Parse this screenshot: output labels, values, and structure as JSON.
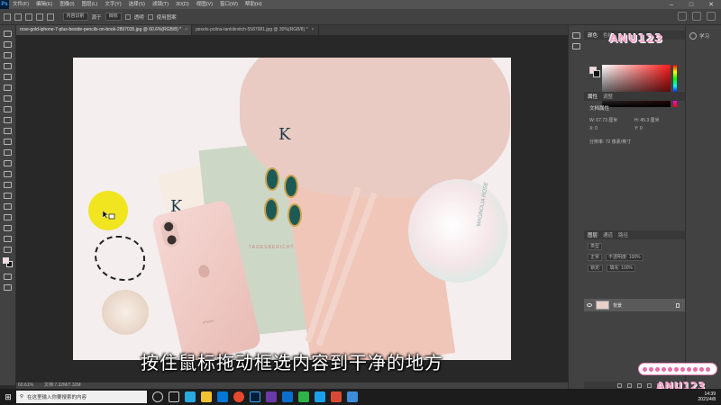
{
  "menubar": {
    "app_icon": "Ps",
    "items": [
      "文件(F)",
      "编辑(E)",
      "图像(I)",
      "图层(L)",
      "文字(Y)",
      "选择(S)",
      "滤镜(T)",
      "3D(D)",
      "视图(V)",
      "窗口(W)",
      "帮助(H)"
    ]
  },
  "optbar": {
    "mode_label": "内容识别",
    "fill_label": "源于",
    "fill_value": "目标",
    "sample_label": "透明",
    "adapt_label": "使用图案"
  },
  "tabs": [
    {
      "label": "rose-gold-iphone-7-plus-beside-pencils-on-book-2897035.jpg @ 60.6%(RGB/8) *",
      "active": true
    },
    {
      "label": "pexels-polina-tankilevitch-5587981.jpg @ 30%(RGB/8) *",
      "active": false
    }
  ],
  "canvas": {
    "subtitle": "按住鼠标拖动框选内容到干净的地方",
    "phone_brand": "iPhone",
    "tin_text": "MAGNOLIA ROSE",
    "notebook_text": "TAGESBERICHT"
  },
  "statusbar": {
    "zoom": "60.61%",
    "doc": "文档:7.32M/7.32M"
  },
  "right_column": {
    "learn": "学习"
  },
  "panels": {
    "color_tabs": [
      "颜色",
      "色板"
    ],
    "props_tabs": [
      "属性",
      "调整"
    ],
    "props_title": "文档属性",
    "width": "W: 67.73 厘米",
    "height": "H: 45.3 厘米",
    "x": "X: 0",
    "y": "Y: 0",
    "resolution": "分辨率: 72 像素/英寸",
    "layers_tabs": [
      "图层",
      "通道",
      "路径"
    ],
    "layer_kind": "类型",
    "blend_mode": "正常",
    "opacity": "不透明度: 100%",
    "lock": "锁定:",
    "fill": "填充: 100%",
    "layer_name": "背景"
  },
  "watermark": "ANU123",
  "taskbar": {
    "search_placeholder": "在这里输入你要搜索的内容",
    "time": "14:39",
    "date": "2021/4/8"
  },
  "colors": {
    "foreground": "#f6d9dd",
    "background": "#111111"
  }
}
